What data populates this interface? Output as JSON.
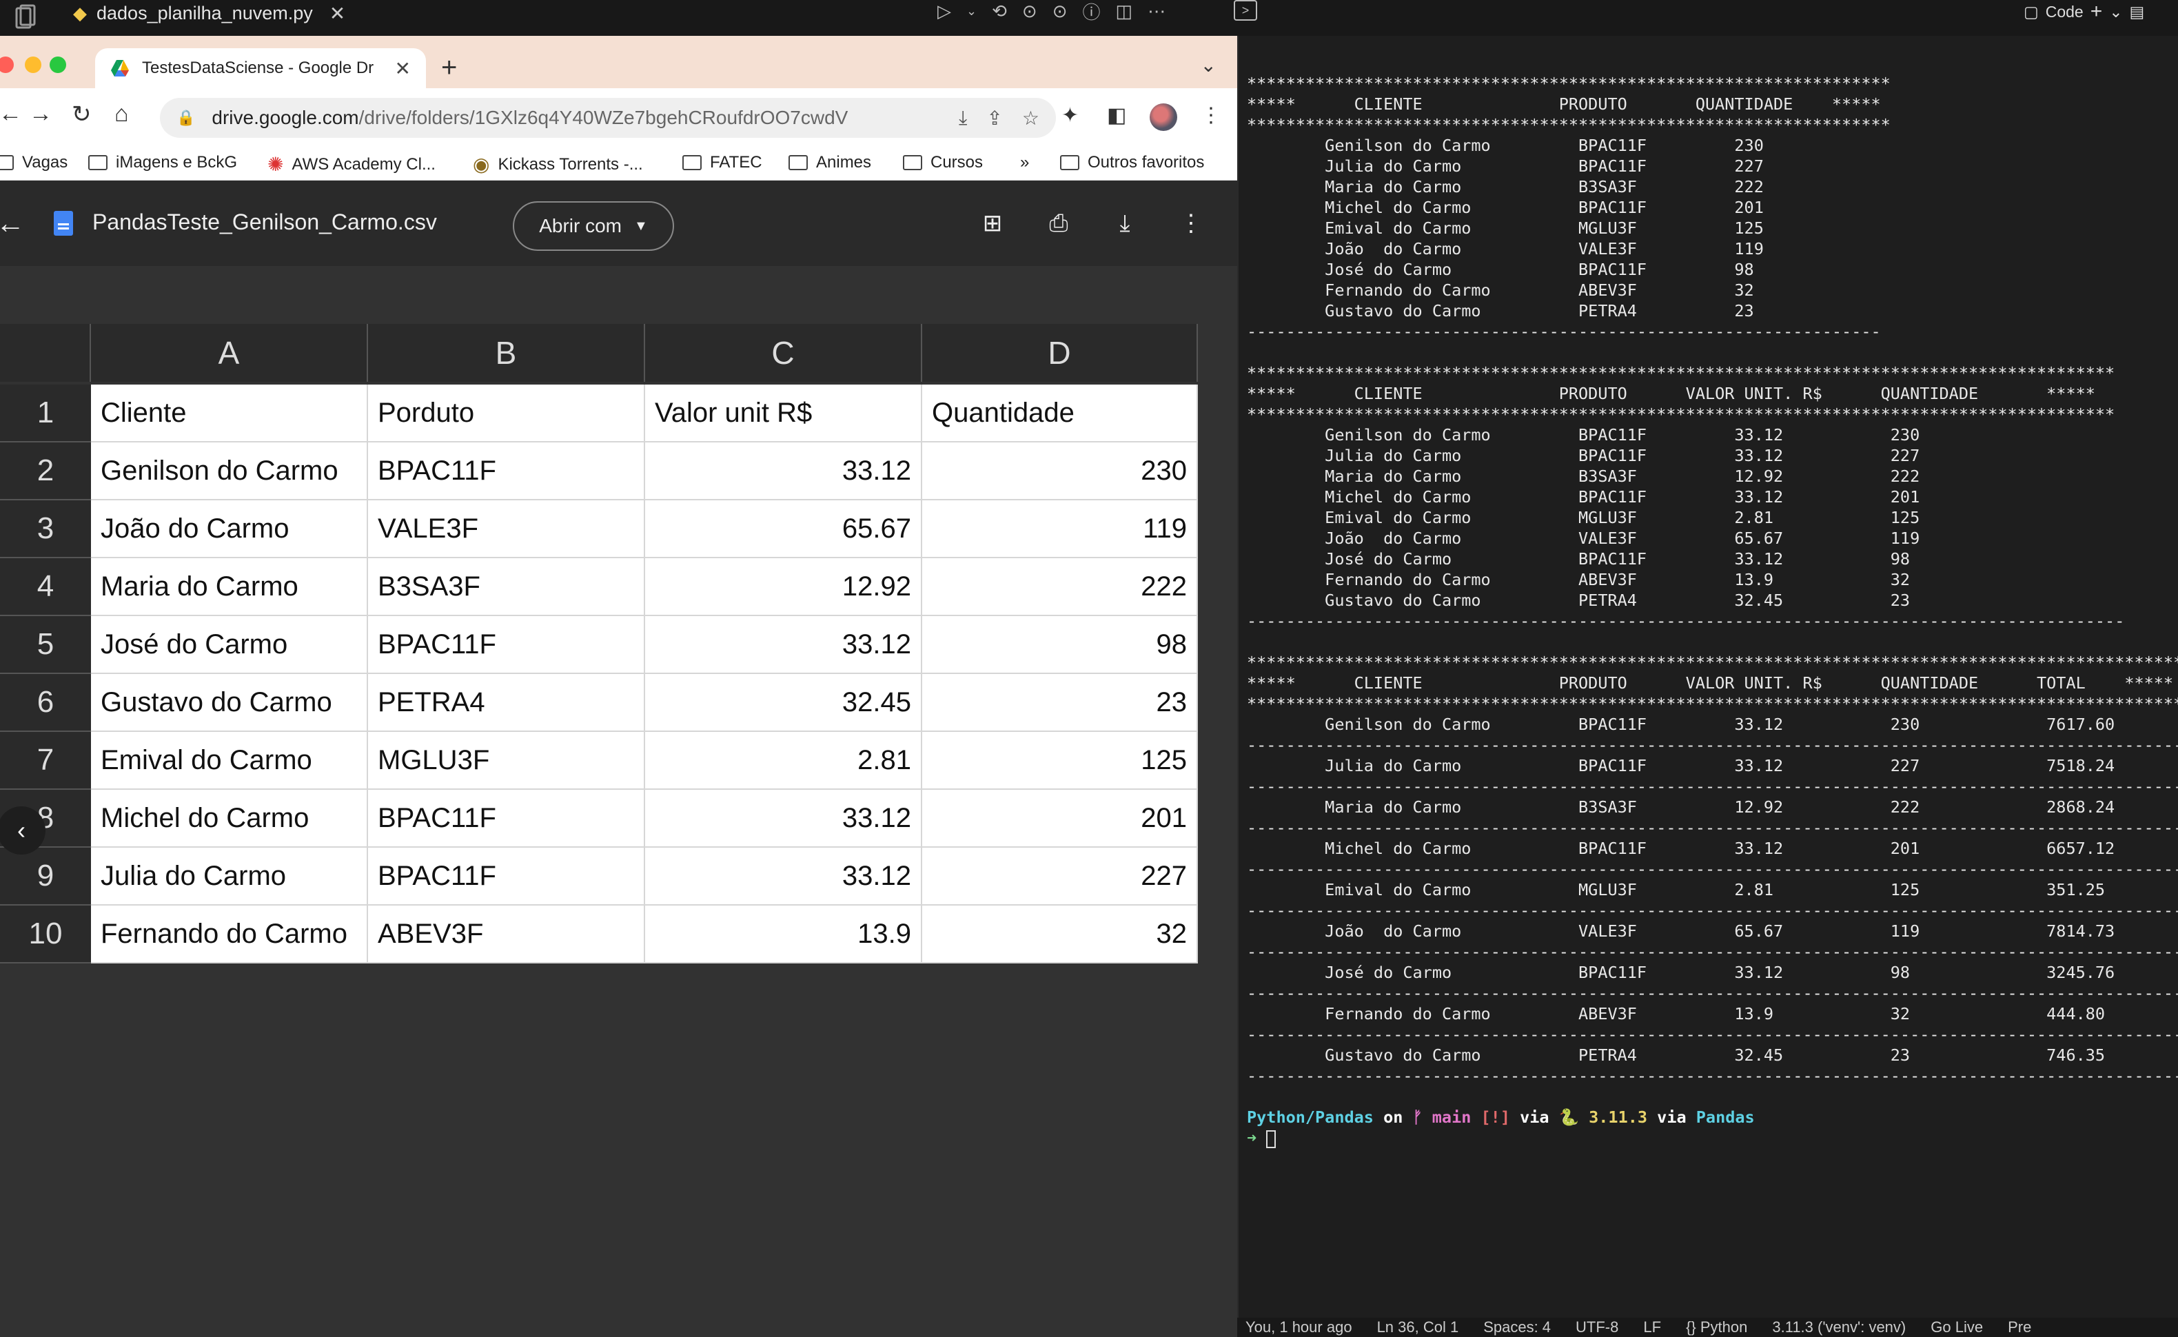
{
  "editor": {
    "file_tab": "dados_planilha_nuvem.py",
    "panel_label": "Code",
    "status_bar": [
      "You, 1 hour ago",
      "Ln 36, Col 1",
      "Spaces: 4",
      "UTF-8",
      "LF",
      "{} Python",
      "3.11.3 ('venv': venv)",
      "Go Live",
      "Pre"
    ]
  },
  "browser": {
    "tab_title": "TestesDataSciense - Google Dr",
    "url_host": "drive.google.com",
    "url_path": "/drive/folders/1GXlz6q4Y40WZe7bgehCRoufdrOO7cwdV",
    "bookmarks": [
      "Vagas",
      "iMagens e BckG",
      "AWS Academy Cl...",
      "Kickass Torrents -...",
      "FATEC",
      "Animes",
      "Cursos",
      "»",
      "Outros favoritos"
    ]
  },
  "viewer": {
    "file_name": "PandasTeste_Genilson_Carmo.csv",
    "open_with_label": "Abrir com"
  },
  "sheet": {
    "columns": [
      "A",
      "B",
      "C",
      "D"
    ],
    "row_numbers": [
      "1",
      "2",
      "3",
      "4",
      "5",
      "6",
      "7",
      "8",
      "9",
      "10"
    ],
    "rows": [
      [
        "Cliente",
        "Porduto",
        "Valor unit R$",
        "Quantidade"
      ],
      [
        "Genilson do Carmo",
        "BPAC11F",
        "33.12",
        "230"
      ],
      [
        "João  do Carmo",
        "VALE3F",
        "65.67",
        "119"
      ],
      [
        "Maria do Carmo",
        "B3SA3F",
        "12.92",
        "222"
      ],
      [
        "José do Carmo",
        "BPAC11F",
        "33.12",
        "98"
      ],
      [
        "Gustavo do Carmo",
        "PETRA4",
        "32.45",
        "23"
      ],
      [
        "Emival do Carmo",
        "MGLU3F",
        "2.81",
        "125"
      ],
      [
        "Michel do Carmo",
        "BPAC11F",
        "33.12",
        "201"
      ],
      [
        "Julia do Carmo",
        "BPAC11F",
        "33.12",
        "227"
      ],
      [
        "Fernando do Carmo",
        "ABEV3F",
        "13.9",
        "32"
      ]
    ]
  },
  "terminal": {
    "lines": [
      "******************************************************************",
      "*****      CLIENTE              PRODUTO       QUANTIDADE    *****",
      "******************************************************************",
      "        Genilson do Carmo         BPAC11F         230",
      "        Julia do Carmo            BPAC11F         227",
      "        Maria do Carmo            B3SA3F          222",
      "        Michel do Carmo           BPAC11F         201",
      "        Emival do Carmo           MGLU3F          125",
      "        João  do Carmo            VALE3F          119",
      "        José do Carmo             BPAC11F         98",
      "        Fernando do Carmo         ABEV3F          32",
      "        Gustavo do Carmo          PETRA4          23",
      "-----------------------------------------------------------------",
      "",
      "*****************************************************************************************",
      "*****      CLIENTE              PRODUTO      VALOR UNIT. R$      QUANTIDADE       *****",
      "*****************************************************************************************",
      "        Genilson do Carmo         BPAC11F         33.12           230",
      "        Julia do Carmo            BPAC11F         33.12           227",
      "        Maria do Carmo            B3SA3F          12.92           222",
      "        Michel do Carmo           BPAC11F         33.12           201",
      "        Emival do Carmo           MGLU3F          2.81            125",
      "        João  do Carmo            VALE3F          65.67           119",
      "        José do Carmo             BPAC11F         33.12           98",
      "        Fernando do Carmo         ABEV3F          13.9            32",
      "        Gustavo do Carmo          PETRA4          32.45           23",
      "------------------------------------------------------------------------------------------",
      "",
      "*******************************************************************************************************",
      "*****      CLIENTE              PRODUTO      VALOR UNIT. R$      QUANTIDADE      TOTAL    *****",
      "*******************************************************************************************************",
      "        Genilson do Carmo         BPAC11F         33.12           230             7617.60",
      "-------------------------------------------------------------------------------------------------------",
      "        Julia do Carmo            BPAC11F         33.12           227             7518.24",
      "-------------------------------------------------------------------------------------------------------",
      "        Maria do Carmo            B3SA3F          12.92           222             2868.24",
      "-------------------------------------------------------------------------------------------------------",
      "        Michel do Carmo           BPAC11F         33.12           201             6657.12",
      "-------------------------------------------------------------------------------------------------------",
      "        Emival do Carmo           MGLU3F          2.81            125             351.25",
      "-------------------------------------------------------------------------------------------------------",
      "        João  do Carmo            VALE3F          65.67           119             7814.73",
      "-------------------------------------------------------------------------------------------------------",
      "        José do Carmo             BPAC11F         33.12           98              3245.76",
      "-------------------------------------------------------------------------------------------------------",
      "        Fernando do Carmo         ABEV3F          13.9            32              444.80",
      "-------------------------------------------------------------------------------------------------------",
      "        Gustavo do Carmo          PETRA4          32.45           23              746.35",
      "-------------------------------------------------------------------------------------------------------",
      ""
    ],
    "prompt": {
      "dir": "Python/Pandas",
      "on": " on ",
      "branch": "ᚠ main",
      "status": " [!]",
      "via1": " via ",
      "python": "🐍 3.11.3",
      "via2": " via ",
      "env": "Pandas",
      "arrow": "➜"
    }
  }
}
